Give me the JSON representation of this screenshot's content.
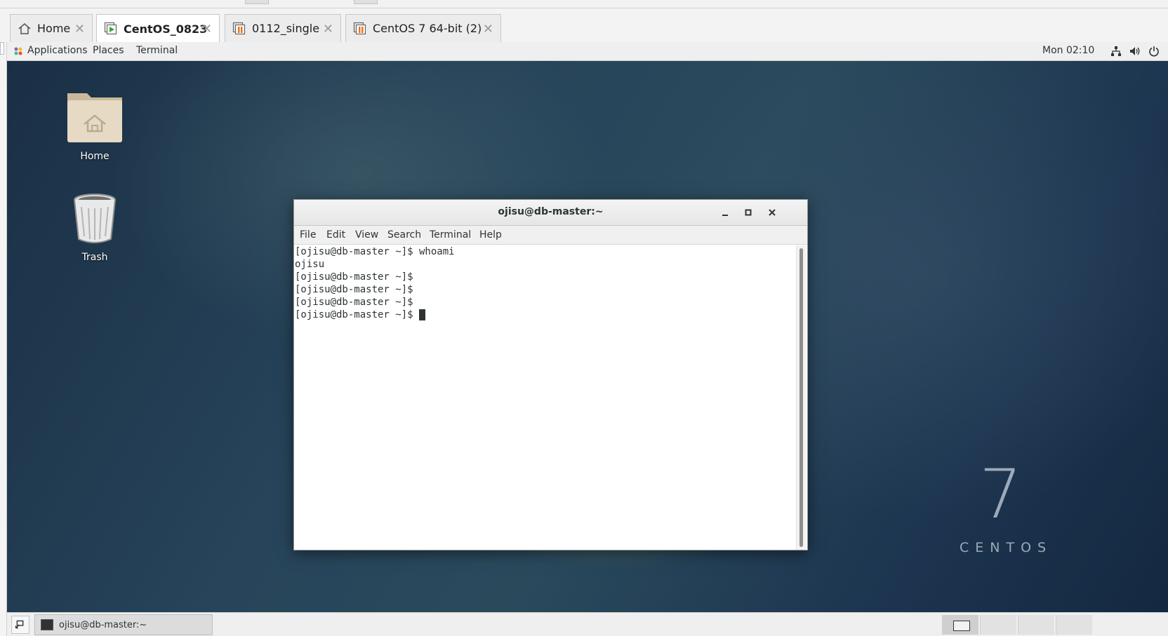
{
  "host": {
    "tabs": [
      {
        "label": "Home",
        "icon": "home-icon",
        "active": false
      },
      {
        "label": "CentOS_0823",
        "icon": "vm-running-icon",
        "active": true
      },
      {
        "label": "0112_single",
        "icon": "vm-suspended-icon",
        "active": false
      },
      {
        "label": "CentOS 7 64-bit (2)",
        "icon": "vm-suspended-icon",
        "active": false
      }
    ],
    "close_glyph": "✕"
  },
  "gnome_top_bar": {
    "applications": "Applications",
    "places": "Places",
    "terminal": "Terminal",
    "clock": "Mon 02:10"
  },
  "desktop": {
    "icons": [
      {
        "label": "Home",
        "icon": "home-folder-icon"
      },
      {
        "label": "Trash",
        "icon": "trash-icon"
      }
    ],
    "branding": {
      "number": "7",
      "word": "CENTOS"
    }
  },
  "terminal_window": {
    "title": "ojisu@db-master:~",
    "menu": [
      "File",
      "Edit",
      "View",
      "Search",
      "Terminal",
      "Help"
    ],
    "lines": [
      "[ojisu@db-master ~]$ whoami",
      "ojisu",
      "[ojisu@db-master ~]$",
      "[ojisu@db-master ~]$",
      "[ojisu@db-master ~]$",
      "[ojisu@db-master ~]$ "
    ]
  },
  "taskbar": {
    "task_label": "ojisu@db-master:~"
  },
  "colors": {
    "desktop_bg": "#27445a",
    "vm_running": "#3aa43a",
    "vm_suspended": "#e8741e"
  }
}
